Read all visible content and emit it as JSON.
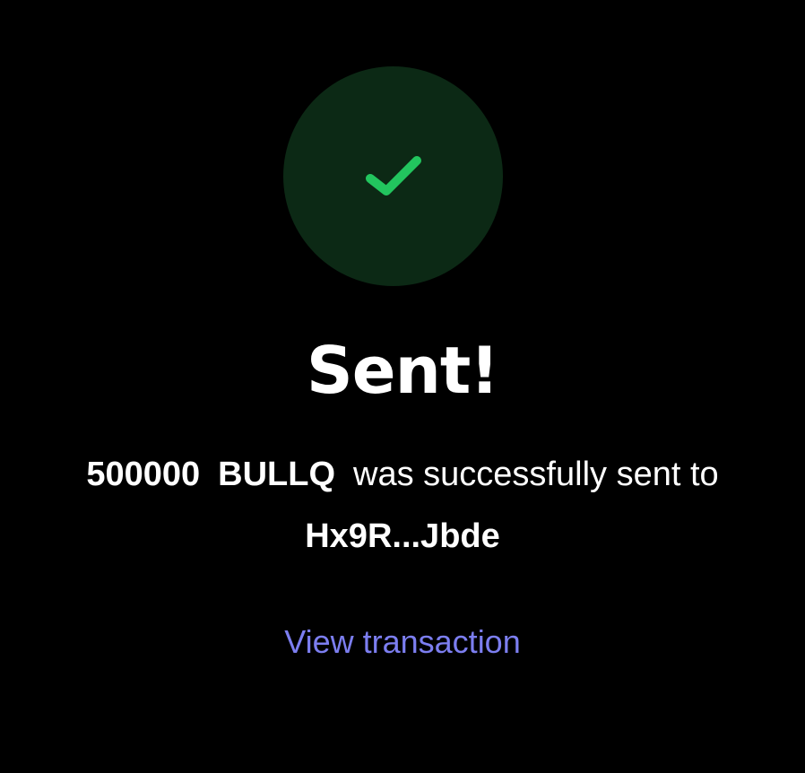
{
  "status": {
    "icon": "checkmark-icon",
    "badge_color": "#0c2915",
    "check_color": "#22c55e",
    "title": "Sent!"
  },
  "message": {
    "amount": "500000",
    "token": "BULLQ",
    "text": "was successfully sent to",
    "recipient": "Hx9R...Jbde"
  },
  "actions": {
    "view_transaction_label": "View transaction",
    "link_color": "#7c7ef0"
  }
}
